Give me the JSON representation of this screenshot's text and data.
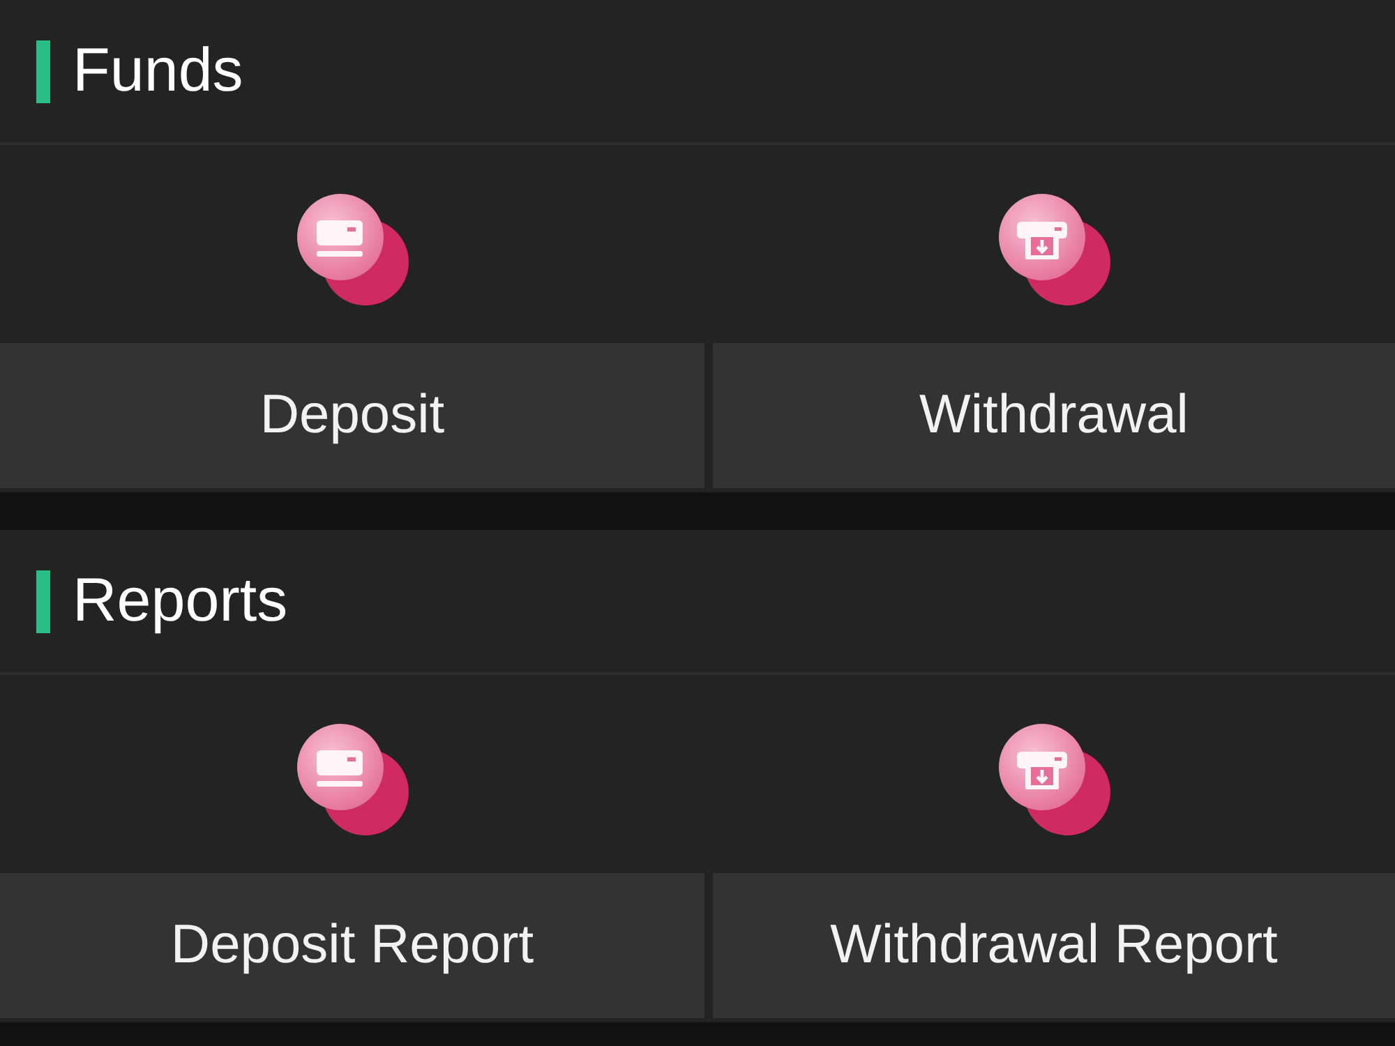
{
  "sections": [
    {
      "title": "Funds",
      "items": [
        {
          "kind": "card",
          "label": "Deposit"
        },
        {
          "kind": "atm",
          "label": "Withdrawal"
        }
      ]
    },
    {
      "title": "Reports",
      "items": [
        {
          "kind": "card",
          "label": "Deposit Report"
        },
        {
          "kind": "atm",
          "label": "Withdrawal Report"
        }
      ]
    }
  ]
}
